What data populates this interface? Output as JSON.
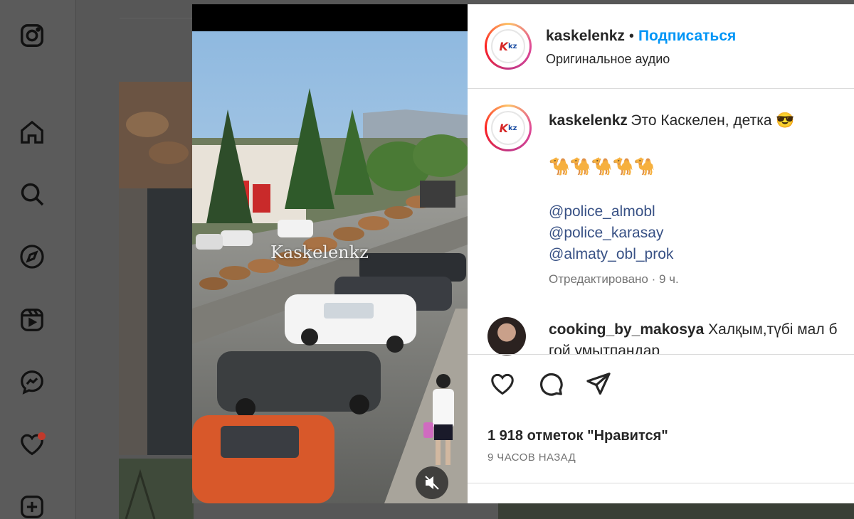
{
  "sidebar": {
    "icons": [
      "instagram-icon",
      "home-icon",
      "search-icon",
      "explore-icon",
      "reels-icon",
      "messenger-icon",
      "heart-icon",
      "create-icon"
    ]
  },
  "video": {
    "watermark": "Kaskelenkz",
    "mute_icon": "speaker-muted-icon"
  },
  "post": {
    "username": "kaskelenkz",
    "separator": "•",
    "follow_label": "Подписаться",
    "audio_label": "Оригинальное аудио",
    "logo_k": "K",
    "logo_kz": "kz"
  },
  "caption": {
    "username": "kaskelenkz",
    "text": "Это Каскелен, детка 😎",
    "emojis": "🐪🐪🐪🐪🐪",
    "mentions": [
      "@police_almobl",
      "@police_karasay",
      "@almaty_obl_prok"
    ],
    "edited": "Отредактировано · 9 ч."
  },
  "comment": {
    "username": "cooking_by_makosya",
    "text": "Халқым,түбі мал б",
    "text_line2": "гой умытпандар"
  },
  "actions": {
    "likes": "1 918 отметок \"Нравится\"",
    "time": "9 ЧАСОВ НАЗАД"
  }
}
